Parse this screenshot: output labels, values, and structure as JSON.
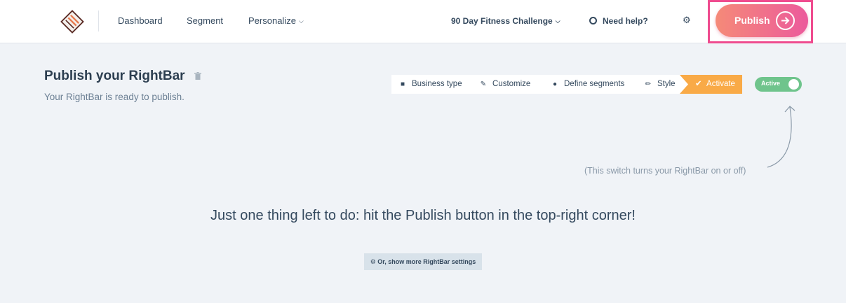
{
  "nav": {
    "logo_icon": "rightbar-logo-icon",
    "links": [
      {
        "label": "Dashboard"
      },
      {
        "label": "Segment"
      },
      {
        "label": "Personalize"
      }
    ],
    "project_name": "90 Day Fitness Challenge",
    "help_label": "Need help?",
    "help_icon": "lifebuoy-icon",
    "settings_icon": "gear-icon",
    "publish_label": "Publish",
    "publish_icon": "arrow-right-circle-icon",
    "publish_gradient": [
      "#f58a78",
      "#ec5a9c"
    ],
    "highlight_color": "#ef4c8f"
  },
  "page": {
    "title": "Publish your RightBar",
    "subtitle": "Your RightBar is ready to publish."
  },
  "steps": [
    {
      "label": "Business type",
      "icon": "briefcase-icon"
    },
    {
      "label": "Customize",
      "icon": "pencil-icon"
    },
    {
      "label": "Define segments",
      "icon": "users-icon"
    },
    {
      "label": "Style",
      "icon": "brush-icon"
    },
    {
      "label": "Activate",
      "icon": "check-icon",
      "active": true
    }
  ],
  "toggle": {
    "label": "Active",
    "on": true,
    "color": "#6fc48c"
  },
  "hint": {
    "text": "(This switch turns your RightBar on or off)"
  },
  "main": {
    "cta_text": "Just one thing left to do: hit the Publish button in the top-right corner!",
    "more_settings_label": "Or, show more RightBar settings",
    "more_settings_icon": "gear-icon"
  },
  "colors": {
    "accent_orange": "#f9aa47",
    "background": "#f0f3f7"
  }
}
